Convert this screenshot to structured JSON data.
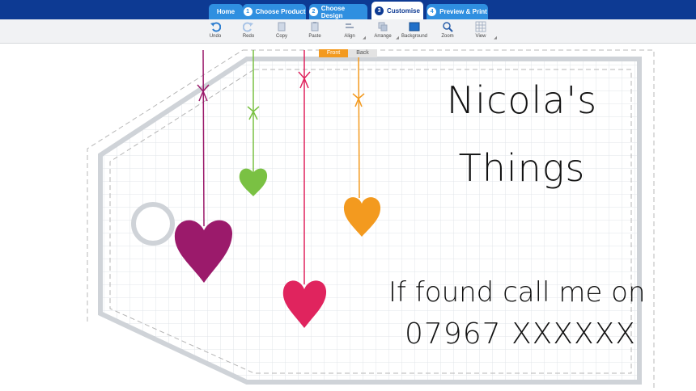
{
  "nav": {
    "tabs": [
      {
        "label": "Home",
        "num": ""
      },
      {
        "label": "Choose Product",
        "num": "1"
      },
      {
        "label": "Choose Design",
        "num": "2"
      },
      {
        "label": "Customise",
        "num": "3"
      },
      {
        "label": "Preview & Print",
        "num": "4"
      }
    ],
    "active_tab": "Customise"
  },
  "toolbar": {
    "undo": "Undo",
    "redo": "Redo",
    "copy": "Copy",
    "paste": "Paste",
    "align": "Align",
    "arrange": "Arrange",
    "background": "Background",
    "zoom": "Zoom",
    "view": "View"
  },
  "sides": {
    "front": "Front",
    "back": "Back",
    "active": "Front"
  },
  "tag": {
    "name_line1": "Nicola's",
    "name_line2": "Things",
    "contact_line1": "If found call me on",
    "contact_line2": "07967 XXXXXX"
  },
  "colors": {
    "topbar": "#0d3a93",
    "tab": "#2f8fe0",
    "front_tab": "#f39a1f",
    "heart_purple": "#9b1a6b",
    "heart_green": "#7ac143",
    "heart_orange": "#f39a1f",
    "heart_pink": "#e0245e"
  },
  "icons": [
    "undo-icon",
    "redo-icon",
    "copy-icon",
    "paste-icon",
    "align-icon",
    "arrange-icon",
    "background-icon",
    "zoom-icon",
    "view-icon"
  ]
}
